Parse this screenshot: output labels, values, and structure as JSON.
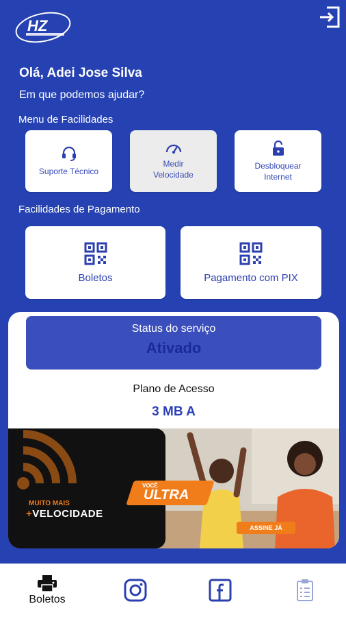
{
  "header": {
    "logo_text": "HZ",
    "logo_icon": "hz-logo",
    "exit_icon": "exit-icon"
  },
  "greeting": "Olá, Adei Jose Silva",
  "help_text": "Em que podemos ajudar?",
  "facilities": {
    "title": "Menu de Facilidades",
    "items": [
      {
        "label": "Suporte Técnico",
        "icon": "headset-icon"
      },
      {
        "label": "Medir Velocidade",
        "icon": "speedometer-icon"
      },
      {
        "label": "Desbloquear Internet",
        "icon": "unlock-icon"
      }
    ]
  },
  "payments": {
    "title": "Facilidades de Pagamento",
    "items": [
      {
        "label": "Boletos",
        "icon": "qr-code-icon"
      },
      {
        "label": "Pagamento com PIX",
        "icon": "qr-code-icon"
      }
    ]
  },
  "status": {
    "title": "Status do serviço",
    "value": "Ativado"
  },
  "plan": {
    "title": "Plano de Acesso",
    "value": "3 MB A"
  },
  "banner": {
    "line1": "MUITO MAIS",
    "line2": "VELOCIDADE",
    "brand_small": "VOCÊ",
    "brand": "ULTRA",
    "cta": "ASSINE JÁ"
  },
  "bottom_nav": {
    "items": [
      {
        "label": "Boletos",
        "icon": "printer-icon"
      },
      {
        "label": "",
        "icon": "instagram-icon"
      },
      {
        "label": "",
        "icon": "facebook-icon"
      },
      {
        "label": "",
        "icon": "clipboard-icon"
      }
    ]
  },
  "colors": {
    "background": "#2541b2",
    "status_box": "#3a4fbc",
    "accent": "#2c3fae",
    "banner_orange": "#f07d1a"
  }
}
